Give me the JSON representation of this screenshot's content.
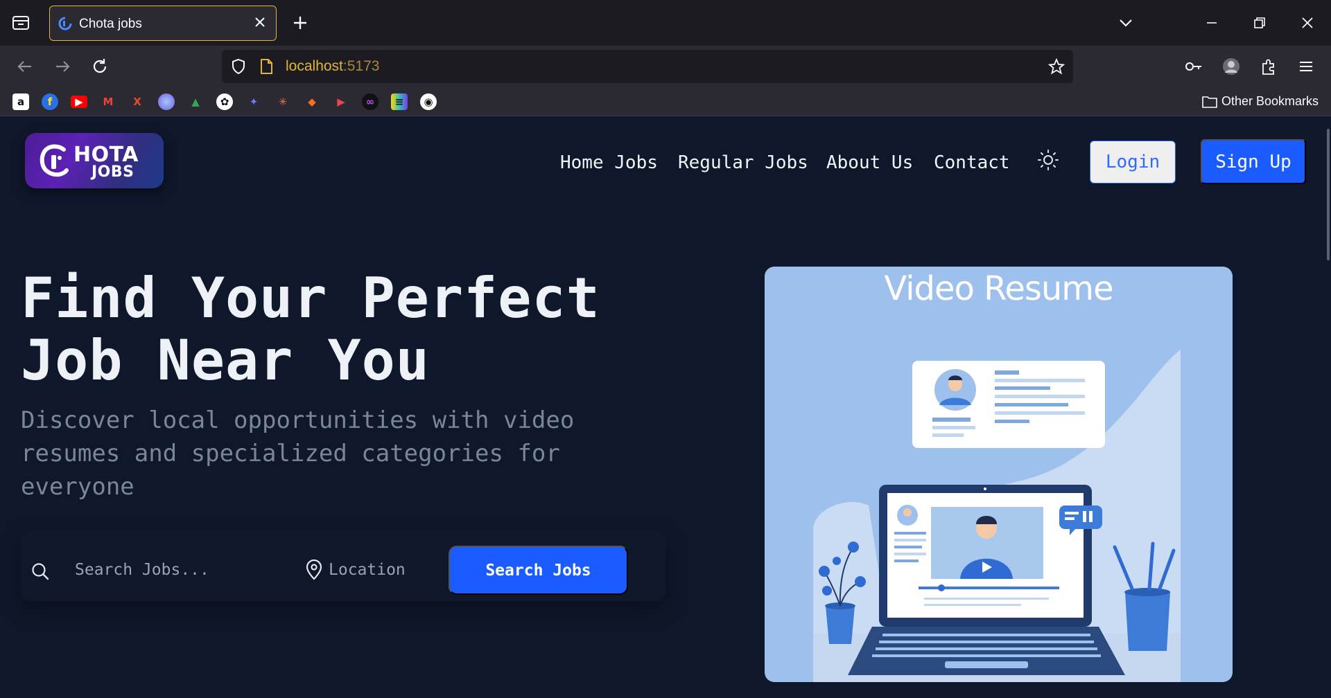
{
  "browser": {
    "tab_title": "Chota jobs",
    "url_host": "localhost",
    "url_port": ":5173",
    "other_bookmarks_label": "Other Bookmarks",
    "bookmarks": [
      "amazon-icon",
      "flipkart-icon",
      "youtube-icon",
      "gmail-icon",
      "x-icon",
      "perplexity-icon",
      "drive-icon",
      "openai-icon",
      "bard-icon",
      "claude-icon",
      "gitlab-icon",
      "send-icon",
      "infinity-icon",
      "codepen-icon",
      "github-icon"
    ]
  },
  "site": {
    "logo_line1": "HOTA",
    "logo_line2": "JOBS",
    "nav": {
      "home": "Home Jobs",
      "regular": "Regular Jobs",
      "about": "About Us",
      "contact": "Contact"
    },
    "login_label": "Login",
    "signup_label": "Sign Up"
  },
  "hero": {
    "title_line1": "Find Your Perfect",
    "title_line2": "Job Near You",
    "subtitle": "Discover local opportunities with video resumes and specialized categories for everyone"
  },
  "search": {
    "jobs_placeholder": "Search Jobs...",
    "location_placeholder": "Location",
    "button_label": "Search Jobs"
  },
  "promo": {
    "title": "Video Resume"
  },
  "colors": {
    "page_bg": "#0f172a",
    "accent_blue": "#1a5cff",
    "promo_bg": "#9dc0ec"
  }
}
